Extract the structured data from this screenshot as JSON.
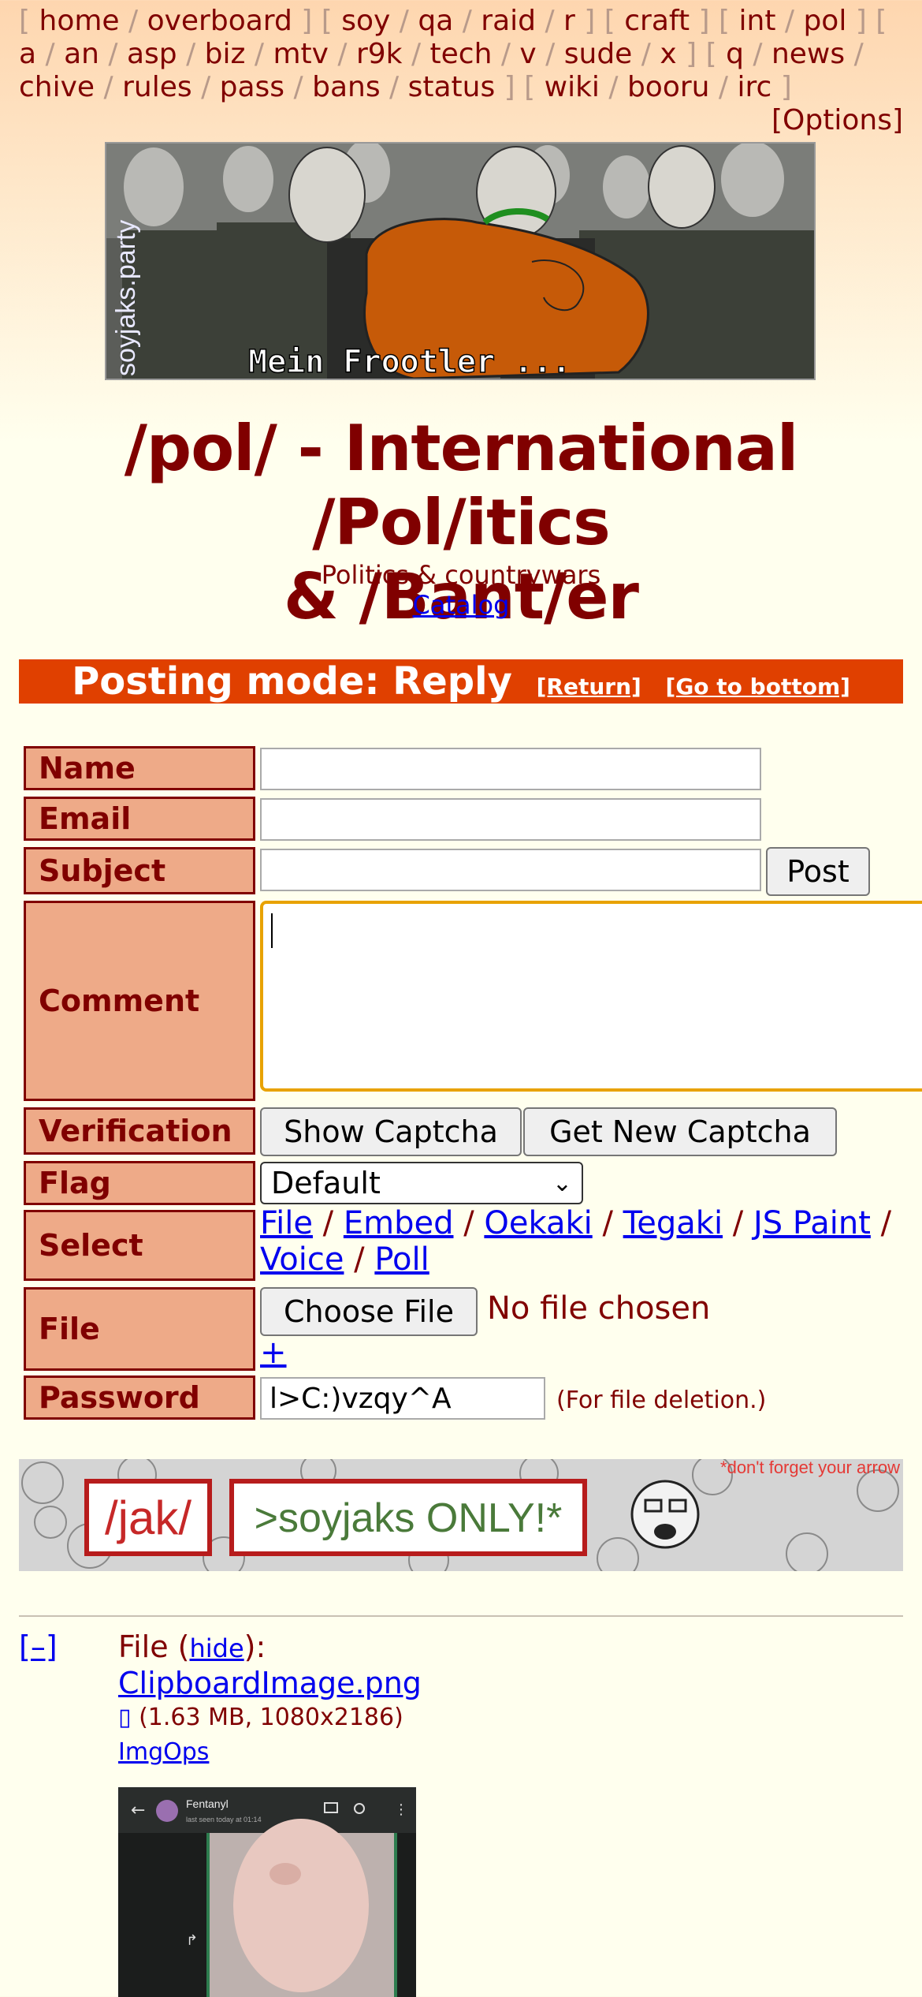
{
  "nav": {
    "links": [
      "home",
      "overboard",
      "soy",
      "qa",
      "raid",
      "r",
      "craft",
      "int",
      "pol",
      "a",
      "an",
      "asp",
      "biz",
      "mtv",
      "r9k",
      "tech",
      "v",
      "sude",
      "x",
      "q",
      "news",
      "chive",
      "rules",
      "pass",
      "bans",
      "status",
      "wiki",
      "booru",
      "irc"
    ],
    "options": "[Options]"
  },
  "banner": {
    "caption": "Mein Frootler ...",
    "watermark": "soyjaks.party"
  },
  "board": {
    "title_line1": "/pol/ - International /Pol/itics",
    "title_line2": "& /Bant/er",
    "subtitle": "Politics & countrywars",
    "catalog": "Catalog"
  },
  "mode": {
    "label": "Posting mode: Reply",
    "return": "[Return]",
    "bottom": "[Go to bottom]"
  },
  "form": {
    "name_label": "Name",
    "email_label": "Email",
    "subject_label": "Subject",
    "post_button": "Post",
    "comment_label": "Comment",
    "verification_label": "Verification",
    "show_captcha": "Show Captcha",
    "new_captcha": "Get New Captcha",
    "flag_label": "Flag",
    "flag_value": "Default",
    "select_label": "Select",
    "select_options": [
      "File",
      "Embed",
      "Oekaki",
      "Tegaki",
      "JS Paint",
      "Voice",
      "Poll"
    ],
    "file_label": "File",
    "choose_file": "Choose File",
    "no_file": "No file chosen",
    "plus": "+",
    "password_label": "Password",
    "password_value": "l>C:)vzqy^A",
    "password_hint": "(For file deletion.)"
  },
  "ad": {
    "left": "/jak/",
    "right": ">soyjaks ONLY!*",
    "note": "*don't forget your arrow"
  },
  "post": {
    "collapse": "[–]",
    "file_prefix": "File (",
    "hide": "hide",
    "file_suffix": "):",
    "filename": "ClipboardImage.png",
    "meta": "(1.63 MB, 1080x2186)",
    "imgops": "ImgOps",
    "thumb_header": "Fentanyl",
    "thumb_status": "last seen today at 01:14"
  },
  "colors": {
    "accent": "#800000",
    "mode_bar": "#e04000",
    "label_bg": "#eeaa88",
    "page_bg": "#ffffee"
  }
}
